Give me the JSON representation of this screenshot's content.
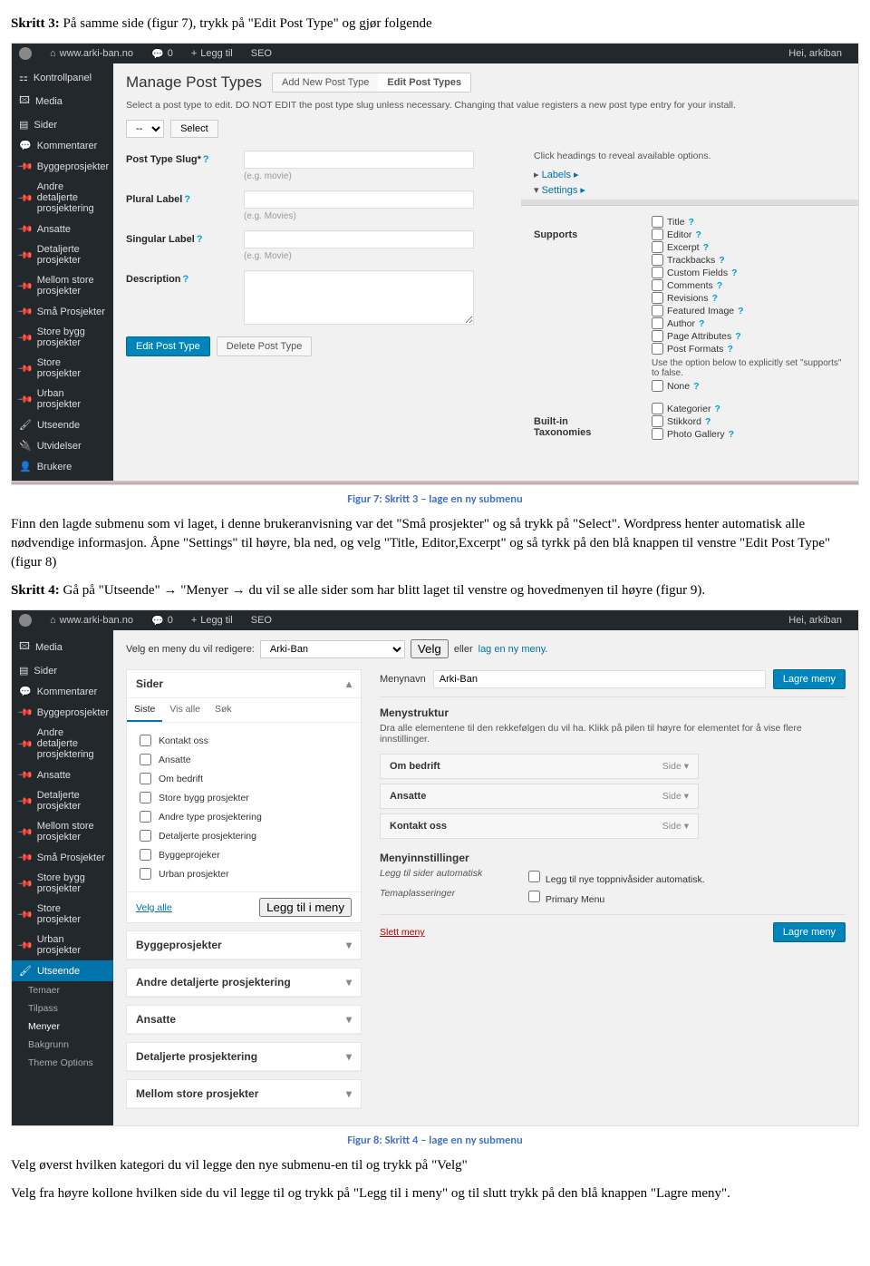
{
  "doc": {
    "step3_lead": "Skritt 3:",
    "step3_text": " På samme side (figur 7), trykk på \"Edit Post Type\" og gjør folgende",
    "cap7_num": "Figur 7:",
    "cap7_txt": " Skritt 3 – lage en ny submenu",
    "para1": "Finn den lagde submenu som vi laget, i denne brukeranvisning var det \"Små prosjekter\" og så trykk på \"Select\". Wordpress henter automatisk alle nødvendige informasjon. Åpne \"Settings\" til høyre, bla ned, og velg \"Title, Editor,Excerpt\" og så tyrkk på den blå knappen til venstre \"Edit Post Type\" (figur 8)",
    "step4_lead": "Skritt 4:",
    "step4_text": " Gå på \"Utseende\" → \"Menyer → du vil se alle sider som har blitt laget til venstre og hovedmenyen til høyre (figur 9).",
    "cap8_num": "Figur 8:",
    "cap8_txt": " Skritt 4 – lage en ny submenu",
    "para2": "Velg øverst hvilken kategori du vil legge den nye submenu-en til og trykk på \"Velg\"",
    "para3": "Velg fra høyre kollone hvilken side du vil legge til og trykk på \"Legg til i meny\" og til slutt trykk på den blå knappen \"Lagre meny\"."
  },
  "shot1": {
    "bar": {
      "site": "www.arki-ban.no",
      "count": "0",
      "add": "Legg til",
      "seo": "SEO",
      "greet": "Hei, arkiban"
    },
    "side_items": [
      "Kontrollpanel",
      "Media",
      "Sider",
      "Kommentarer",
      "Byggeprosjekter",
      "Andre detaljerte prosjektering",
      "Ansatte",
      "Detaljerte prosjekter",
      "Mellom store prosjekter",
      "Små Prosjekter",
      "Store bygg prosjekter",
      "Store prosjekter",
      "Urban prosjekter",
      "Utseende",
      "Utvidelser",
      "Brukere"
    ],
    "title": "Manage Post Types",
    "tab1": "Add New Post Type",
    "tab2": "Edit Post Types",
    "hint": "Select a post type to edit. DO NOT EDIT the post type slug unless necessary. Changing that value registers a new post type entry for your install.",
    "select_ph": "--",
    "select_btn": "Select",
    "fields": {
      "slug": "Post Type Slug*",
      "slug_ph": "(e.g. movie)",
      "plural": "Plural Label",
      "plural_ph": "(e.g. Movies)",
      "singular": "Singular Label",
      "singular_ph": "(e.g. Movie)",
      "desc": "Description"
    },
    "btn_edit": "Edit Post Type",
    "btn_del": "Delete Post Type",
    "right": {
      "reveal": "Click headings to reveal available options.",
      "labels": "Labels",
      "settings": "Settings",
      "supports": "Supports",
      "support_items": [
        "Title",
        "Editor",
        "Excerpt",
        "Trackbacks",
        "Custom Fields",
        "Comments",
        "Revisions",
        "Featured Image",
        "Author",
        "Page Attributes",
        "Post Formats"
      ],
      "note": "Use the option below to explicitly set \"supports\" to false.",
      "none": "None",
      "tax": "Built-in Taxonomies",
      "tax_items": [
        "Kategorier",
        "Stikkord",
        "Photo Gallery"
      ]
    }
  },
  "shot2": {
    "bar": {
      "site": "www.arki-ban.no",
      "count": "0",
      "add": "Legg til",
      "seo": "SEO",
      "greet": "Hei, arkiban"
    },
    "side_items": [
      "Media",
      "Sider",
      "Kommentarer",
      "Byggeprosjekter",
      "Andre detaljerte prosjektering",
      "Ansatte",
      "Detaljerte prosjekter",
      "Mellom store prosjekter",
      "Små Prosjekter",
      "Store bygg prosjekter",
      "Store prosjekter",
      "Urban prosjekter",
      "Utseende"
    ],
    "side_subs": [
      "Temaer",
      "Tilpass",
      "Menyer",
      "Bakgrunn",
      "Theme Options"
    ],
    "top": {
      "label": "Velg en meny du vil redigere:",
      "sel": "Arki-Ban",
      "btn": "Velg",
      "or": "eller",
      "link": "lag en ny meny."
    },
    "left_panel": {
      "h": "Sider",
      "tabs": [
        "Siste",
        "Vis alle",
        "Søk"
      ],
      "items": [
        "Kontakt oss",
        "Ansatte",
        "Om bedrift",
        "Store bygg prosjekter",
        "Andre type prosjektering",
        "Detaljerte prosjektering",
        "Byggeprojeker",
        "Urban prosjekter"
      ],
      "velg_alle": "Velg alle",
      "add_btn": "Legg til i meny",
      "collapsed": [
        "Byggeprosjekter",
        "Andre detaljerte prosjektering",
        "Ansatte",
        "Detaljerte prosjektering",
        "Mellom store prosjekter"
      ]
    },
    "right_panel": {
      "menuname_lbl": "Menynavn",
      "menuname": "Arki-Ban",
      "save": "Lagre meny",
      "struct_h": "Menystruktur",
      "struct_hint": "Dra alle elementene til den rekkefølgen du vil ha. Klikk på pilen til høyre for elementet for å vise flere innstillinger.",
      "items": [
        {
          "name": "Om bedrift",
          "type": "Side"
        },
        {
          "name": "Ansatte",
          "type": "Side"
        },
        {
          "name": "Kontakt oss",
          "type": "Side"
        }
      ],
      "settings_h": "Menyinnstillinger",
      "auto_lbl": "Legg til sider automatisk",
      "auto_opt": "Legg til nye toppnivåsider automatisk.",
      "theme_lbl": "Temaplasseringer",
      "theme_opt": "Primary Menu",
      "delete": "Slett meny"
    }
  }
}
